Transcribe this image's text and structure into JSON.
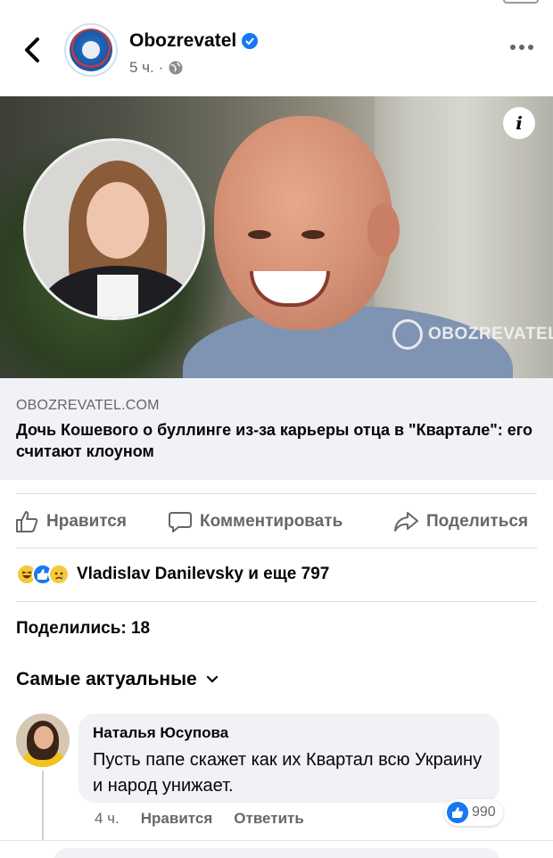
{
  "header": {
    "page_name": "Obozrevatel",
    "time": "5 ч.",
    "separator": "·"
  },
  "photo": {
    "watermark": "OBOZREVATEL",
    "info_glyph": "i"
  },
  "link_preview": {
    "domain": "OBOZREVATEL.COM",
    "title": "Дочь Кошевого о буллинге из-за карьеры отца в \"Квартале\": его считают клоуном"
  },
  "actions": {
    "like": "Нравится",
    "comment": "Комментировать",
    "share": "Поделиться"
  },
  "reactions": {
    "summary": "Vladislav Danilevsky и еще 797",
    "icons": [
      "haha-icon",
      "like-icon",
      "sad-icon"
    ]
  },
  "shares": "Поделились: 18",
  "sort": {
    "label": "Самые актуальные"
  },
  "comment": {
    "author": "Наталья Юсупова",
    "text": "Пусть папе скажет как их Квартал всю Украину и народ унижает.",
    "time": "4 ч.",
    "like": "Нравится",
    "reply": "Ответить",
    "reaction_count": "990"
  },
  "colors": {
    "accent": "#1877f2",
    "secondary_text": "#65676b",
    "link_bg": "#f0f2f5"
  }
}
